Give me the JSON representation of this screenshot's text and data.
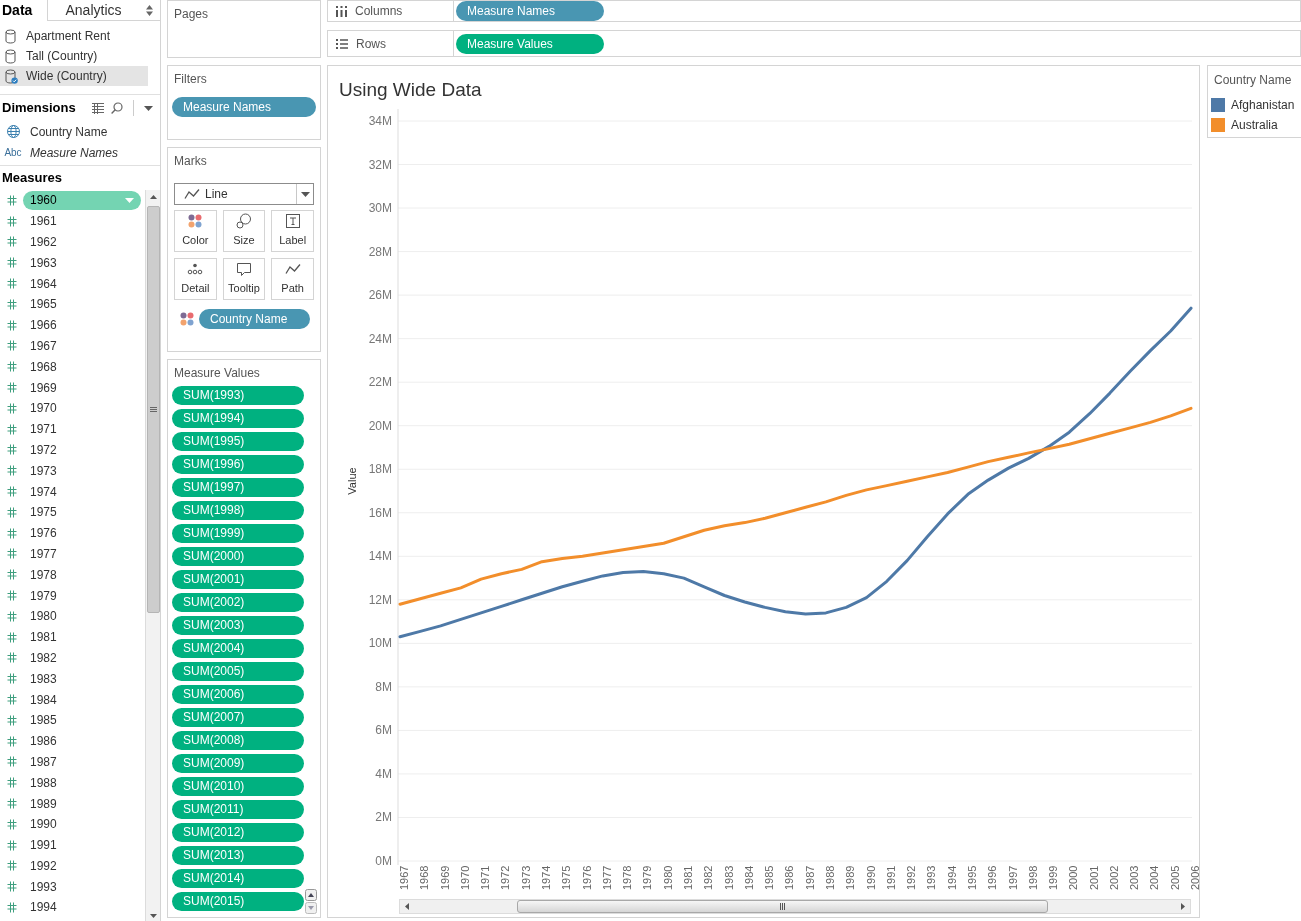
{
  "data_pane": {
    "tabs": [
      {
        "label": "Data",
        "selected": true
      },
      {
        "label": "Analytics",
        "selected": false
      }
    ],
    "data_sources": [
      {
        "name": "Apartment Rent",
        "selected": false
      },
      {
        "name": "Tall (Country)",
        "selected": false
      },
      {
        "name": "Wide (Country)",
        "selected": true
      }
    ],
    "dimensions": {
      "title": "Dimensions",
      "fields": [
        {
          "name": "Country Name",
          "kind": "geo"
        },
        {
          "name": "Measure Names",
          "kind": "generated",
          "type_label": "Abc"
        }
      ]
    },
    "measures": {
      "title": "Measures",
      "fields": [
        {
          "name": "1960",
          "selected": true
        },
        {
          "name": "1961",
          "selected": false
        },
        {
          "name": "1962",
          "selected": false
        },
        {
          "name": "1963",
          "selected": false
        },
        {
          "name": "1964",
          "selected": false
        },
        {
          "name": "1965",
          "selected": false
        },
        {
          "name": "1966",
          "selected": false
        },
        {
          "name": "1967",
          "selected": false
        },
        {
          "name": "1968",
          "selected": false
        },
        {
          "name": "1969",
          "selected": false
        },
        {
          "name": "1970",
          "selected": false
        },
        {
          "name": "1971",
          "selected": false
        },
        {
          "name": "1972",
          "selected": false
        },
        {
          "name": "1973",
          "selected": false
        },
        {
          "name": "1974",
          "selected": false
        },
        {
          "name": "1975",
          "selected": false
        },
        {
          "name": "1976",
          "selected": false
        },
        {
          "name": "1977",
          "selected": false
        },
        {
          "name": "1978",
          "selected": false
        },
        {
          "name": "1979",
          "selected": false
        },
        {
          "name": "1980",
          "selected": false
        },
        {
          "name": "1981",
          "selected": false
        },
        {
          "name": "1982",
          "selected": false
        },
        {
          "name": "1983",
          "selected": false
        },
        {
          "name": "1984",
          "selected": false
        },
        {
          "name": "1985",
          "selected": false
        },
        {
          "name": "1986",
          "selected": false
        },
        {
          "name": "1987",
          "selected": false
        },
        {
          "name": "1988",
          "selected": false
        },
        {
          "name": "1989",
          "selected": false
        },
        {
          "name": "1990",
          "selected": false
        },
        {
          "name": "1991",
          "selected": false
        },
        {
          "name": "1992",
          "selected": false
        },
        {
          "name": "1993",
          "selected": false
        },
        {
          "name": "1994",
          "selected": false
        }
      ]
    }
  },
  "pages": {
    "title": "Pages"
  },
  "filters": {
    "title": "Filters",
    "pills": [
      {
        "label": "Measure Names",
        "kind": "dimension"
      }
    ]
  },
  "marks": {
    "title": "Marks",
    "mark_type": {
      "label": "Line",
      "kind": "line"
    },
    "buttons": [
      {
        "label": "Color",
        "kind": "color"
      },
      {
        "label": "Size",
        "kind": "size"
      },
      {
        "label": "Label",
        "kind": "label"
      },
      {
        "label": "Detail",
        "kind": "detail"
      },
      {
        "label": "Tooltip",
        "kind": "tooltip"
      },
      {
        "label": "Path",
        "kind": "path"
      }
    ],
    "encodings": [
      {
        "kind": "color",
        "pill": {
          "label": "Country Name",
          "kind": "dimension"
        }
      }
    ]
  },
  "measure_values": {
    "title": "Measure Values",
    "pills": [
      {
        "label": "SUM(1993)",
        "kind": "measure"
      },
      {
        "label": "SUM(1994)",
        "kind": "measure"
      },
      {
        "label": "SUM(1995)",
        "kind": "measure"
      },
      {
        "label": "SUM(1996)",
        "kind": "measure"
      },
      {
        "label": "SUM(1997)",
        "kind": "measure"
      },
      {
        "label": "SUM(1998)",
        "kind": "measure"
      },
      {
        "label": "SUM(1999)",
        "kind": "measure"
      },
      {
        "label": "SUM(2000)",
        "kind": "measure"
      },
      {
        "label": "SUM(2001)",
        "kind": "measure"
      },
      {
        "label": "SUM(2002)",
        "kind": "measure"
      },
      {
        "label": "SUM(2003)",
        "kind": "measure"
      },
      {
        "label": "SUM(2004)",
        "kind": "measure"
      },
      {
        "label": "SUM(2005)",
        "kind": "measure"
      },
      {
        "label": "SUM(2006)",
        "kind": "measure"
      },
      {
        "label": "SUM(2007)",
        "kind": "measure"
      },
      {
        "label": "SUM(2008)",
        "kind": "measure"
      },
      {
        "label": "SUM(2009)",
        "kind": "measure"
      },
      {
        "label": "SUM(2010)",
        "kind": "measure"
      },
      {
        "label": "SUM(2011)",
        "kind": "measure"
      },
      {
        "label": "SUM(2012)",
        "kind": "measure"
      },
      {
        "label": "SUM(2013)",
        "kind": "measure"
      },
      {
        "label": "SUM(2014)",
        "kind": "measure"
      },
      {
        "label": "SUM(2015)",
        "kind": "measure"
      }
    ]
  },
  "shelves": [
    {
      "kind": "columns",
      "label": "Columns",
      "pills": [
        {
          "label": "Measure Names",
          "kind": "dimension"
        }
      ]
    },
    {
      "kind": "rows",
      "label": "Rows",
      "pills": [
        {
          "label": "Measure Values",
          "kind": "measure"
        }
      ]
    }
  ],
  "view": {
    "chart_data": {
      "type": "line",
      "title": "Using Wide Data",
      "ylabel": "Value",
      "grid": true,
      "categories": [
        "1967",
        "1968",
        "1969",
        "1970",
        "1971",
        "1972",
        "1973",
        "1974",
        "1975",
        "1976",
        "1977",
        "1978",
        "1979",
        "1980",
        "1981",
        "1982",
        "1983",
        "1984",
        "1985",
        "1986",
        "1987",
        "1988",
        "1989",
        "1990",
        "1991",
        "1992",
        "1993",
        "1994",
        "1995",
        "1996",
        "1997",
        "1998",
        "1999",
        "2000",
        "2001",
        "2002",
        "2003",
        "2004",
        "2005",
        "2006"
      ],
      "series": [
        {
          "name": "Afghanistan",
          "color": "#4e79a7",
          "values": [
            10.3,
            10.55,
            10.8,
            11.1,
            11.4,
            11.7,
            12.0,
            12.3,
            12.6,
            12.85,
            13.1,
            13.25,
            13.3,
            13.2,
            13.0,
            12.6,
            12.2,
            11.9,
            11.65,
            11.45,
            11.35,
            11.4,
            11.65,
            12.1,
            12.85,
            13.8,
            14.9,
            15.95,
            16.85,
            17.5,
            18.05,
            18.5,
            19.05,
            19.7,
            20.55,
            21.5,
            22.5,
            23.45,
            24.35,
            25.4
          ]
        },
        {
          "name": "Australia",
          "color": "#f28e2b",
          "values": [
            11.8,
            12.05,
            12.3,
            12.55,
            12.95,
            13.2,
            13.4,
            13.75,
            13.9,
            14.0,
            14.15,
            14.3,
            14.45,
            14.6,
            14.9,
            15.2,
            15.4,
            15.55,
            15.75,
            16.0,
            16.25,
            16.5,
            16.8,
            17.05,
            17.25,
            17.45,
            17.65,
            17.85,
            18.1,
            18.35,
            18.55,
            18.75,
            18.95,
            19.15,
            19.4,
            19.65,
            19.9,
            20.15,
            20.45,
            20.8
          ]
        }
      ],
      "ylim": [
        0,
        34
      ],
      "yticks": [
        {
          "value": 0,
          "label": "0M"
        },
        {
          "value": 2,
          "label": "2M"
        },
        {
          "value": 4,
          "label": "4M"
        },
        {
          "value": 6,
          "label": "6M"
        },
        {
          "value": 8,
          "label": "8M"
        },
        {
          "value": 10,
          "label": "10M"
        },
        {
          "value": 12,
          "label": "12M"
        },
        {
          "value": 14,
          "label": "14M"
        },
        {
          "value": 16,
          "label": "16M"
        },
        {
          "value": 18,
          "label": "18M"
        },
        {
          "value": 20,
          "label": "20M"
        },
        {
          "value": 22,
          "label": "22M"
        },
        {
          "value": 24,
          "label": "24M"
        },
        {
          "value": 26,
          "label": "26M"
        },
        {
          "value": 28,
          "label": "28M"
        },
        {
          "value": 30,
          "label": "30M"
        },
        {
          "value": 32,
          "label": "32M"
        },
        {
          "value": 34,
          "label": "34M"
        }
      ]
    }
  },
  "legend": {
    "title": "Country Name"
  }
}
